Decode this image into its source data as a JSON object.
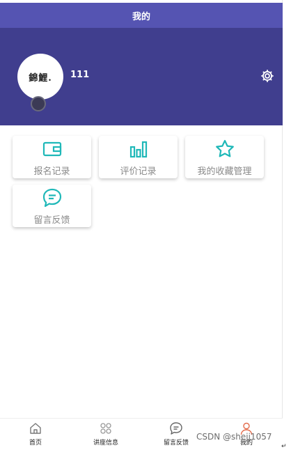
{
  "header": {
    "title": "我的"
  },
  "profile": {
    "avatar_text": "錦鯉.",
    "username": "111",
    "settings_icon": "gear-icon"
  },
  "menu": {
    "items": [
      {
        "label": "报名记录",
        "icon": "wallet-icon"
      },
      {
        "label": "评价记录",
        "icon": "bar-chart-icon"
      },
      {
        "label": "我的收藏管理",
        "icon": "star-icon"
      },
      {
        "label": "留言反馈",
        "icon": "chat-bubble-icon"
      }
    ],
    "accent_color": "#1fb8b8"
  },
  "tabbar": {
    "items": [
      {
        "label": "首页",
        "icon": "home-icon"
      },
      {
        "label": "讲座信息",
        "icon": "grid-icon"
      },
      {
        "label": "留言反馈",
        "icon": "chat-icon"
      },
      {
        "label": "我的",
        "icon": "user-icon",
        "active": true
      }
    ],
    "active_color": "#e36a4a"
  },
  "watermark": "CSDN @shejj1057",
  "colors": {
    "header_bg": "#5554b2",
    "profile_bg": "#403e8e"
  }
}
